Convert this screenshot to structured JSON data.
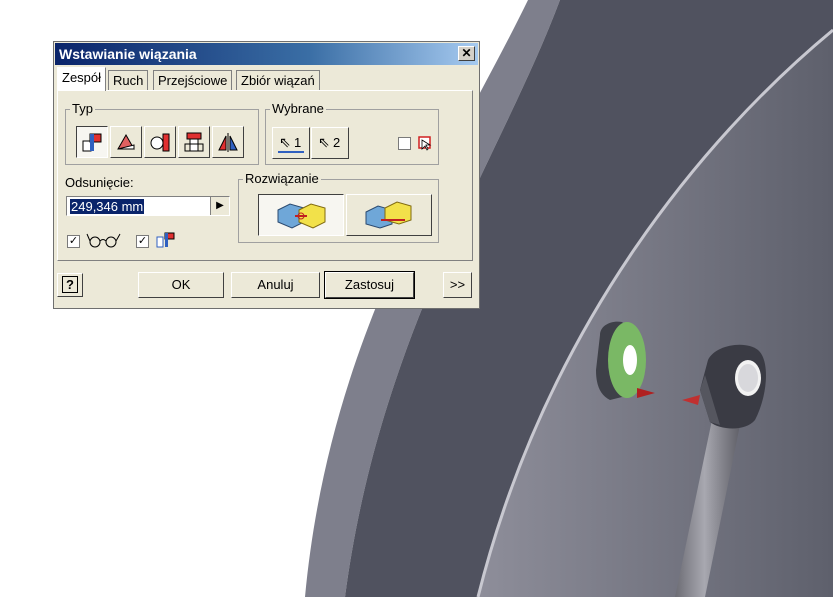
{
  "dialog": {
    "title": "Wstawianie wiązania",
    "close_label": "✕",
    "tabs": [
      "Zespół",
      "Ruch",
      "Przejściowe",
      "Zbiór wiązań"
    ],
    "groups": {
      "typ": "Typ",
      "wybrane": "Wybrane",
      "odsuniecie": "Odsunięcie:",
      "rozwiazanie": "Rozwiązanie"
    },
    "offset_value": "249,346 mm",
    "selection_1": "1",
    "selection_2": "2",
    "help_label": "?",
    "buttons": {
      "ok": "OK",
      "cancel": "Anuluj",
      "apply": "Zastosuj",
      "more": ">>"
    }
  },
  "colors": {
    "accent": "#0a246a",
    "model_dark": "#4a4c5a",
    "model_light": "#8a8c98",
    "washer_face": "#7ab865"
  }
}
